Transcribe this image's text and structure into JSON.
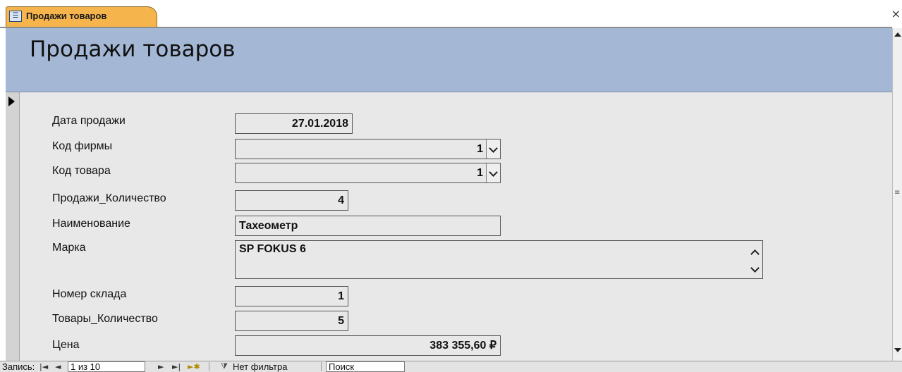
{
  "tab": {
    "label": "Продажи товаров",
    "close": "×"
  },
  "form": {
    "title": "Продажи товаров"
  },
  "fields": {
    "sale_date": {
      "label": "Дата продажи",
      "value": "27.01.2018"
    },
    "company_code": {
      "label": "Код фирмы",
      "value": "1"
    },
    "product_code": {
      "label": "Код товара",
      "value": "1"
    },
    "sale_qty": {
      "label": "Продажи_Количество",
      "value": "4"
    },
    "name": {
      "label": "Наименование",
      "value": "Тахеометр"
    },
    "brand": {
      "label": "Марка",
      "value": "SP FOKUS 6"
    },
    "warehouse": {
      "label": "Номер склада",
      "value": "1"
    },
    "goods_qty": {
      "label": "Товары_Количество",
      "value": "5"
    },
    "price": {
      "label": "Цена",
      "value": "383 355,60 ₽"
    }
  },
  "nav": {
    "record_label": "Запись:",
    "first": "|◄",
    "prev": "◄",
    "position": "1 из 10",
    "next": "►",
    "last": "►|",
    "new": "►✱",
    "filter_label": "Нет фильтра",
    "search": "Поиск"
  },
  "colors": {
    "header": "#a4b8d6",
    "detail": "#e8e8e8",
    "tab": "#f6b54c"
  }
}
